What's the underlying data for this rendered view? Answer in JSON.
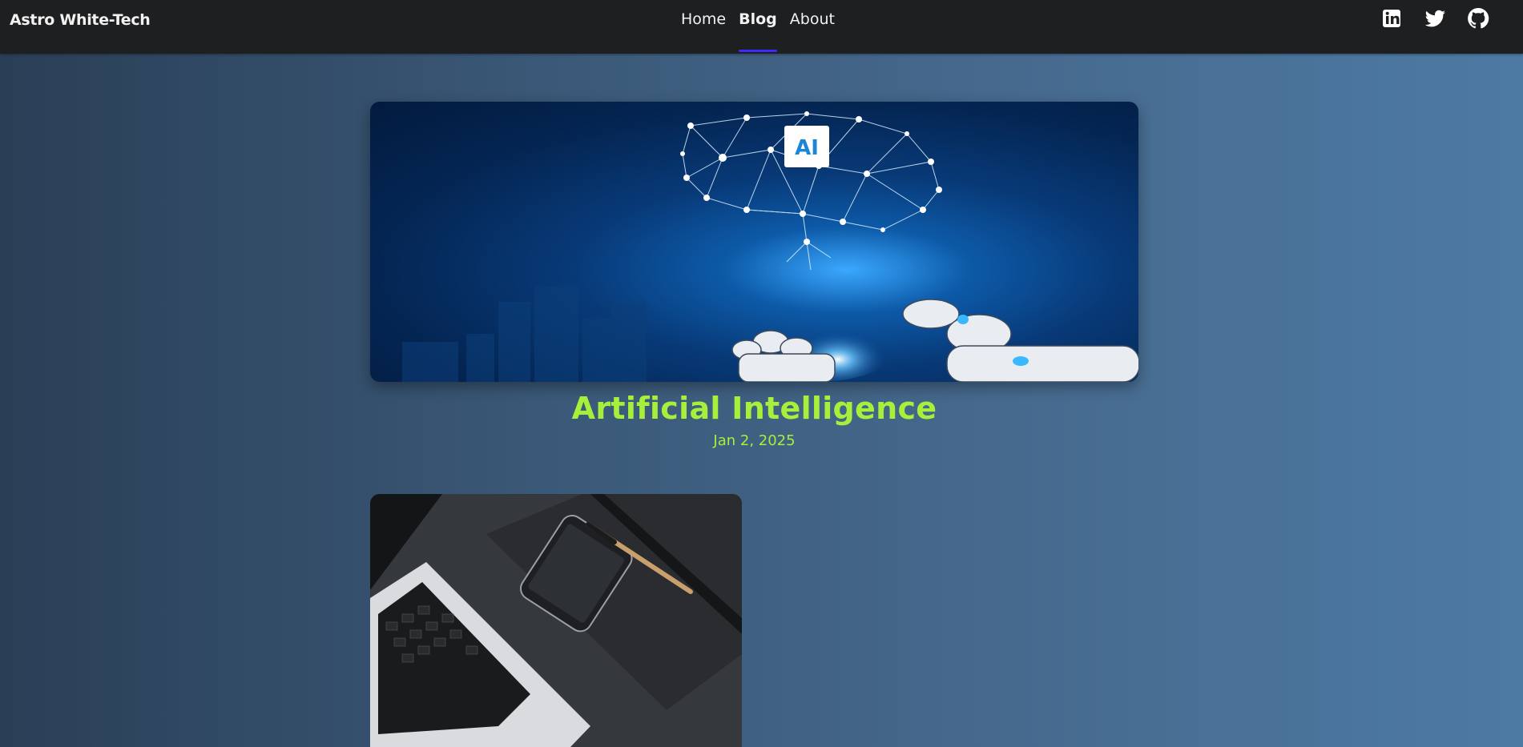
{
  "header": {
    "brand": "Astro White-Tech",
    "nav": [
      {
        "label": "Home"
      },
      {
        "label": "Blog"
      },
      {
        "label": "About"
      }
    ],
    "active_nav": "Blog",
    "socials": [
      "linkedin-icon",
      "twitter-icon",
      "github-icon"
    ]
  },
  "posts": [
    {
      "title": "Artificial Intelligence",
      "date": "Jan 2, 2025",
      "image_badge": "AI"
    }
  ],
  "colors": {
    "accent": "#a6f03c",
    "nav_underline": "#3b2bff",
    "header_bg": "#1e1f21"
  }
}
